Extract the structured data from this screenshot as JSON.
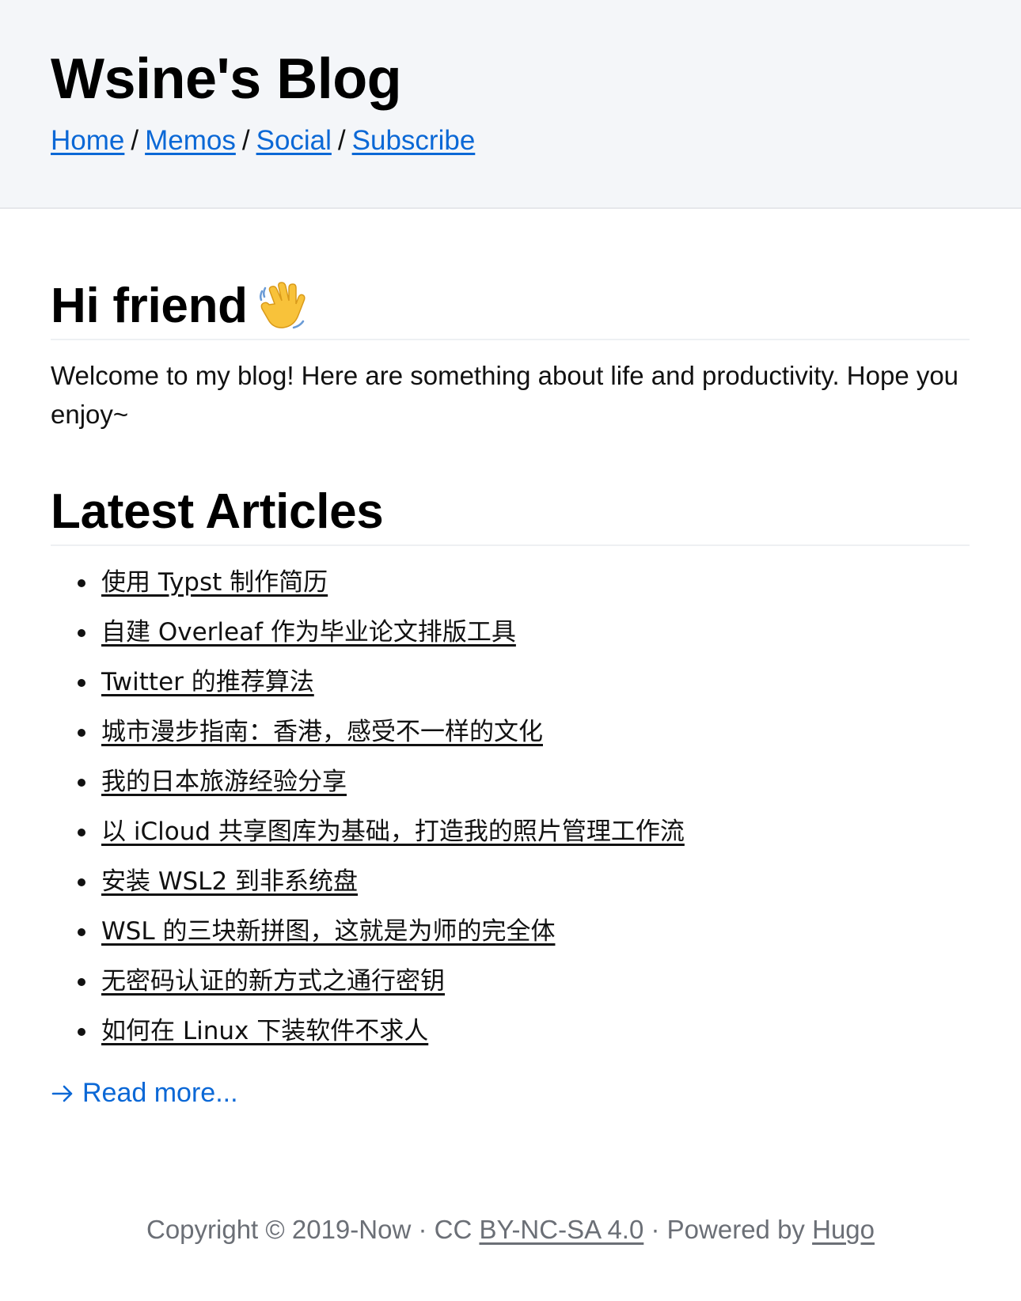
{
  "header": {
    "site_title": "Wsine's Blog",
    "nav": {
      "home": "Home",
      "memos": "Memos",
      "social": "Social",
      "subscribe": "Subscribe",
      "separator": "/"
    }
  },
  "intro": {
    "title": "Hi friend",
    "title_icon": "waving-hand-icon",
    "text": "Welcome to my blog! Here are something about life and productivity. Hope you enjoy~"
  },
  "latest": {
    "title": "Latest Articles",
    "articles": [
      "使用 Typst 制作简历",
      "自建 Overleaf 作为毕业论文排版工具",
      "Twitter 的推荐算法",
      "城市漫步指南：香港，感受不一样的文化",
      "我的日本旅游经验分享",
      "以 iCloud 共享图库为基础，打造我的照片管理工作流",
      "安装 WSL2 到非系统盘",
      "WSL 的三块新拼图，这就是为师的完全体",
      "无密码认证的新方式之通行密钥",
      "如何在 Linux 下装软件不求人"
    ],
    "read_more": "Read more...",
    "read_more_icon": "arrow-right-icon"
  },
  "footer": {
    "copyright": "Copyright © 2019-Now · CC ",
    "license": "BY-NC-SA 4.0",
    "powered_by": " · Powered by ",
    "engine": "Hugo"
  },
  "colors": {
    "link": "#0b68d6",
    "header_bg": "#f4f6f9",
    "footer_text": "#6b6f76"
  }
}
